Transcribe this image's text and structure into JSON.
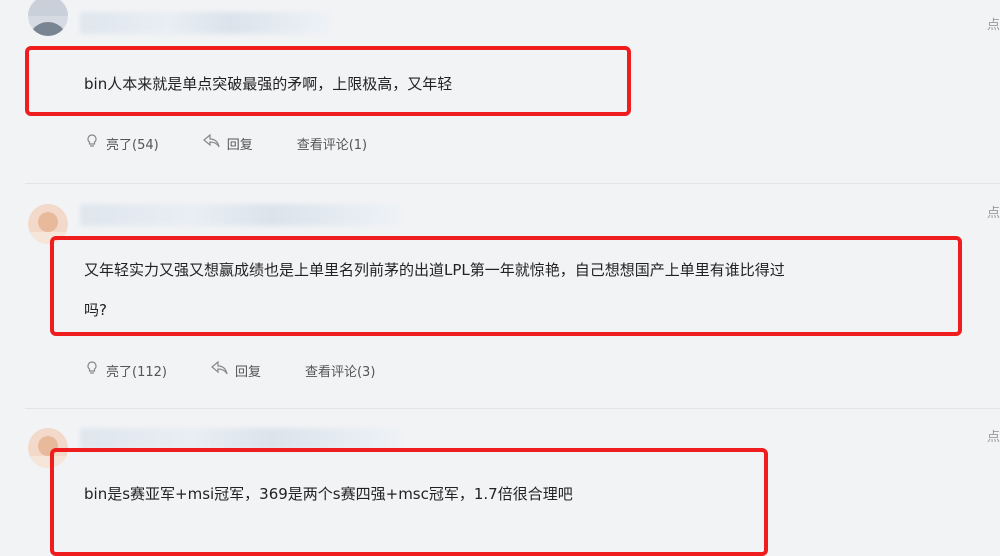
{
  "comments": [
    {
      "corner": "点",
      "text": "bin人本来就是单点突破最强的矛啊，上限极高，又年轻",
      "text_line2": "",
      "like_label": "亮了(54)",
      "reply_label": "回复",
      "view_replies_label": "查看评论(1)"
    },
    {
      "corner": "点",
      "text": "又年轻实力又强又想赢成绩也是上单里名列前茅的出道LPL第一年就惊艳，自己想想国产上单里有谁比得过",
      "text_line2": "吗?",
      "like_label": "亮了(112)",
      "reply_label": "回复",
      "view_replies_label": "查看评论(3)"
    },
    {
      "corner": "点",
      "text": "bin是s赛亚军+msi冠军，369是两个s赛四强+msc冠军，1.7倍很合理吧",
      "text_line2": "",
      "like_label": "",
      "reply_label": "",
      "view_replies_label": ""
    }
  ],
  "colors": {
    "highlight_box": "#ef1d1d",
    "background": "#f2f3f5"
  },
  "icons": [
    "like-icon",
    "reply-icon"
  ]
}
